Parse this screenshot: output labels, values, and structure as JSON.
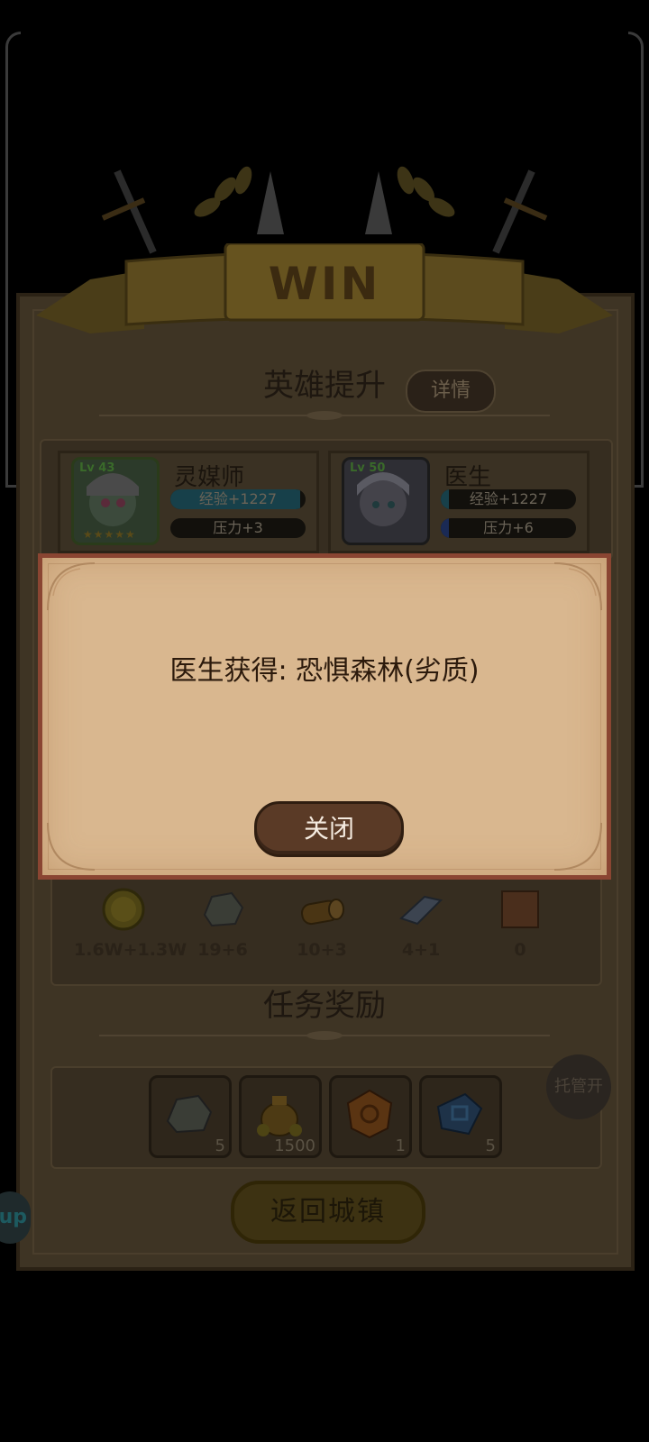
{
  "result": {
    "title": "WIN"
  },
  "hero_section": {
    "title": "英雄提升",
    "detail_button": "详情",
    "heroes": [
      {
        "level": "Lv 43",
        "name": "灵媒师",
        "exp": "经验+1227",
        "stress": "压力+3",
        "stars": "★★★★★"
      },
      {
        "level": "Lv 50",
        "name": "医生",
        "exp": "经验+1227",
        "stress": "压力+6"
      }
    ]
  },
  "loot": [
    {
      "icon": "gold-coin-icon",
      "value": "1.6W+1.3W"
    },
    {
      "icon": "ore-stone-icon",
      "value": "19+6"
    },
    {
      "icon": "wood-log-icon",
      "value": "10+3"
    },
    {
      "icon": "metal-ingot-icon",
      "value": "4+1"
    },
    {
      "icon": "leather-hide-icon",
      "value": "0"
    }
  ],
  "task_section": {
    "title": "任务奖励",
    "rewards": [
      {
        "icon": "ore-stone-icon",
        "count": "5"
      },
      {
        "icon": "gold-bag-icon",
        "count": "1500"
      },
      {
        "icon": "orange-gem-icon",
        "count": "1"
      },
      {
        "icon": "blue-crystal-icon",
        "count": "5"
      }
    ]
  },
  "auto_button": "托管开",
  "return_button": "返回城镇",
  "side_tab": "up",
  "dialog": {
    "message": "医生获得: 恐惧森林(劣质)",
    "close_button": "关闭"
  },
  "colors": {
    "dialog_bg": "#d9b78f",
    "dialog_border": "#8a4532",
    "close_button": "#5a3a26"
  }
}
